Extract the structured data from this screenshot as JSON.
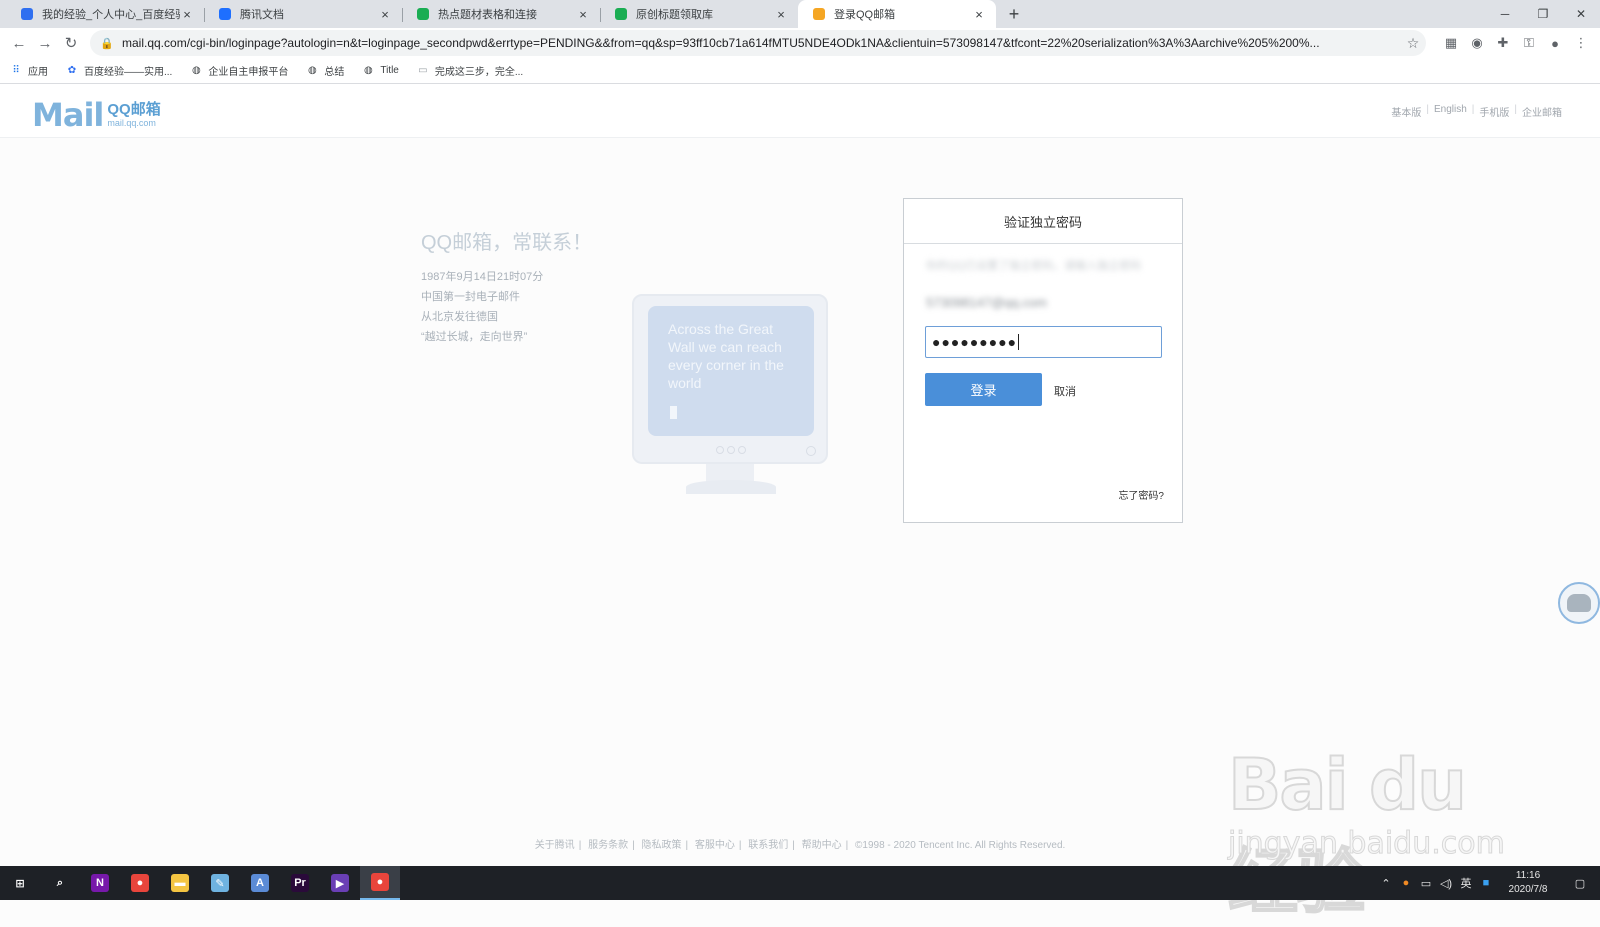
{
  "browser": {
    "tabs": [
      {
        "title": "我的经验_个人中心_百度经验",
        "icon": "baidu-paw-icon",
        "color": "#2f6ff0"
      },
      {
        "title": "腾讯文档",
        "icon": "tencent-docs-icon",
        "color": "#1e6fff"
      },
      {
        "title": "热点题材表格和连接",
        "icon": "sheet-icon",
        "color": "#1aad53"
      },
      {
        "title": "原创标题领取库",
        "icon": "sheet-icon",
        "color": "#1aad53"
      },
      {
        "title": "登录QQ邮箱",
        "icon": "qqmail-icon",
        "color": "#f5a623",
        "active": true
      }
    ],
    "new_tab": "+",
    "close_glyph": "×",
    "url_host": "mail.qq.com",
    "url_rest": "/cgi-bin/loginpage?autologin=n&t=loginpage_secondpwd&errtype=PENDING&&from=qq&sp=93ff10cb71a614fMTU5NDE4ODk1NA&clientuin=573098147&tfcont=22%20serialization%3A%3Aarchive%205%200%...",
    "bookmarks": [
      {
        "label": "应用",
        "icon": "apps-grid-icon"
      },
      {
        "label": "百度经验——实用...",
        "icon": "baidu-paw-icon"
      },
      {
        "label": "企业自主申报平台",
        "icon": "globe-icon"
      },
      {
        "label": "总结",
        "icon": "globe-icon"
      },
      {
        "label": "Title",
        "icon": "globe-icon"
      },
      {
        "label": "完成这三步，完全...",
        "icon": "page-icon"
      }
    ]
  },
  "mail": {
    "logo_text": "Mail",
    "logo_cn": "QQ邮箱",
    "logo_domain": "mail.qq.com",
    "top_links": [
      "基本版",
      "English",
      "手机版",
      "企业邮箱"
    ],
    "slogan": "QQ邮箱，常联系！",
    "intro_lines": [
      "1987年9月14日21时07分",
      "中国第一封电子邮件",
      "从北京发往德国",
      "“越过长城，走向世界”"
    ],
    "monitor_text": "Across the Great Wall we can reach every corner in the world",
    "login": {
      "heading": "验证独立密码",
      "blurred_line": "你的QQ已设置了独立密码，请输入独立密码",
      "blurred_account": "573098147@qq.com",
      "password_mask": "●●●●●●●●●",
      "login_button": "登录",
      "cancel_link": "取消",
      "forgot_link": "忘了密码?"
    },
    "footer": [
      "关于腾讯",
      "服务条款",
      "隐私政策",
      "客服中心",
      "联系我们",
      "帮助中心",
      "©1998 - 2020 Tencent Inc. All Rights Reserved."
    ]
  },
  "watermark": {
    "big": "Bai du经验",
    "small": "jingyan.baidu.com"
  },
  "taskbar": {
    "apps": [
      {
        "name": "start-icon",
        "label": "⊞",
        "color": "#ffffff"
      },
      {
        "name": "search-icon",
        "label": "⌕",
        "color": "#ffffff"
      },
      {
        "name": "onenote-icon",
        "label": "N",
        "color": "#7719aa"
      },
      {
        "name": "chrome-icon",
        "label": "●",
        "color": "#e8453c"
      },
      {
        "name": "file-explorer-icon",
        "label": "▬",
        "color": "#f4c542"
      },
      {
        "name": "notepad-icon",
        "label": "✎",
        "color": "#6fb3e0"
      },
      {
        "name": "vector-app-icon",
        "label": "A",
        "color": "#5b8bd6"
      },
      {
        "name": "premiere-icon",
        "label": "Pr",
        "color": "#2a0a3a"
      },
      {
        "name": "media-player-icon",
        "label": "▶",
        "color": "#6a3fb5"
      },
      {
        "name": "chrome-active-icon",
        "label": "●",
        "color": "#e8453c",
        "active": true
      }
    ],
    "tray": {
      "ime": "英",
      "time": "11:16",
      "date": "2020/7/8"
    }
  }
}
